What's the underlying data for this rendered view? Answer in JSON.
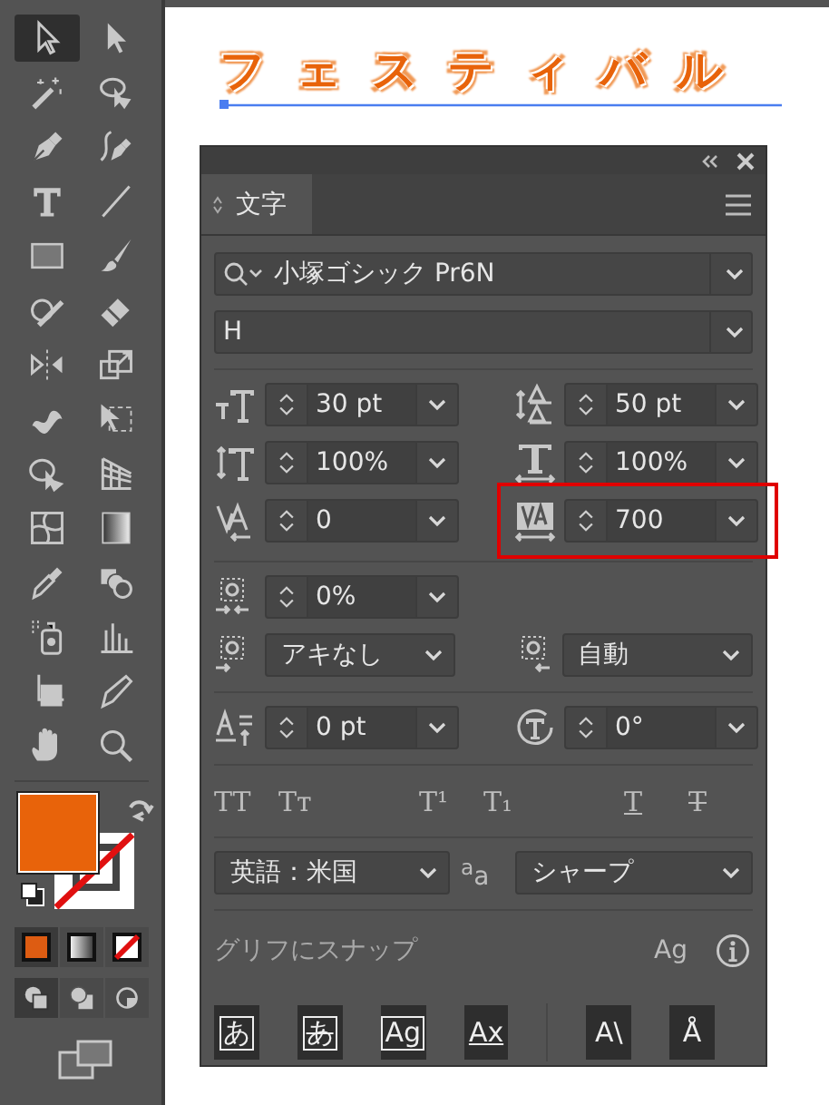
{
  "tools": [
    {
      "selected": true
    },
    {
      "selected": false
    },
    {
      "selected": false
    },
    {
      "selected": false
    },
    {
      "selected": false
    },
    {
      "selected": false
    },
    {
      "selected": false
    },
    {
      "selected": false
    },
    {
      "selected": false
    },
    {
      "selected": false
    },
    {
      "selected": false
    },
    {
      "selected": false
    },
    {
      "selected": false
    },
    {
      "selected": false
    },
    {
      "selected": false
    },
    {
      "selected": false
    },
    {
      "selected": false
    },
    {
      "selected": false
    },
    {
      "selected": false
    },
    {
      "selected": false
    },
    {
      "selected": false
    },
    {
      "selected": false
    },
    {
      "selected": false
    },
    {
      "selected": false
    },
    {
      "selected": false
    },
    {
      "selected": false
    },
    {
      "selected": false
    },
    {
      "selected": false
    }
  ],
  "canvas_text": "フェスティバル",
  "panel": {
    "tabs": [
      {
        "label": "文字",
        "selected": true
      }
    ],
    "font_family": "小塚ゴシック Pr6N",
    "font_style": "H",
    "metrics": [
      {
        "value": "30 pt",
        "highlighted": false
      },
      {
        "value": "50 pt",
        "highlighted": false
      },
      {
        "value": "100%",
        "highlighted": false
      },
      {
        "value": "100%",
        "highlighted": false
      },
      {
        "value": "0",
        "highlighted": false
      },
      {
        "value": "700",
        "highlighted": true
      }
    ],
    "tsume": "0%",
    "aki_left": "アキなし",
    "aki_right": "自動",
    "baseline": "0 pt",
    "rotation": "0°",
    "style_buttons": [
      {
        "kind": "caps",
        "label": "TT"
      },
      {
        "kind": "smallcaps",
        "label": "Tᴛ"
      },
      {
        "kind": "super",
        "label": "T¹"
      },
      {
        "kind": "sub",
        "label": "T₁"
      },
      {
        "kind": "underline",
        "label": "T"
      },
      {
        "kind": "strike",
        "label": "T"
      }
    ],
    "language": "英語：米国",
    "antialias_mark": "$^{a}$a",
    "antialias": "シャープ",
    "snap_label": "グリフにスナップ",
    "snap_icon_label": "Ag",
    "bottom_buttons": [
      {
        "kind": "frame",
        "label": "あ"
      },
      {
        "kind": "strike",
        "label": "あ"
      },
      {
        "kind": "frame",
        "label": "Ag"
      },
      {
        "kind": "underline",
        "label": "Ax"
      },
      {
        "kind": "plain",
        "label": "A\\"
      },
      {
        "kind": "plain",
        "label": "Å"
      }
    ]
  }
}
